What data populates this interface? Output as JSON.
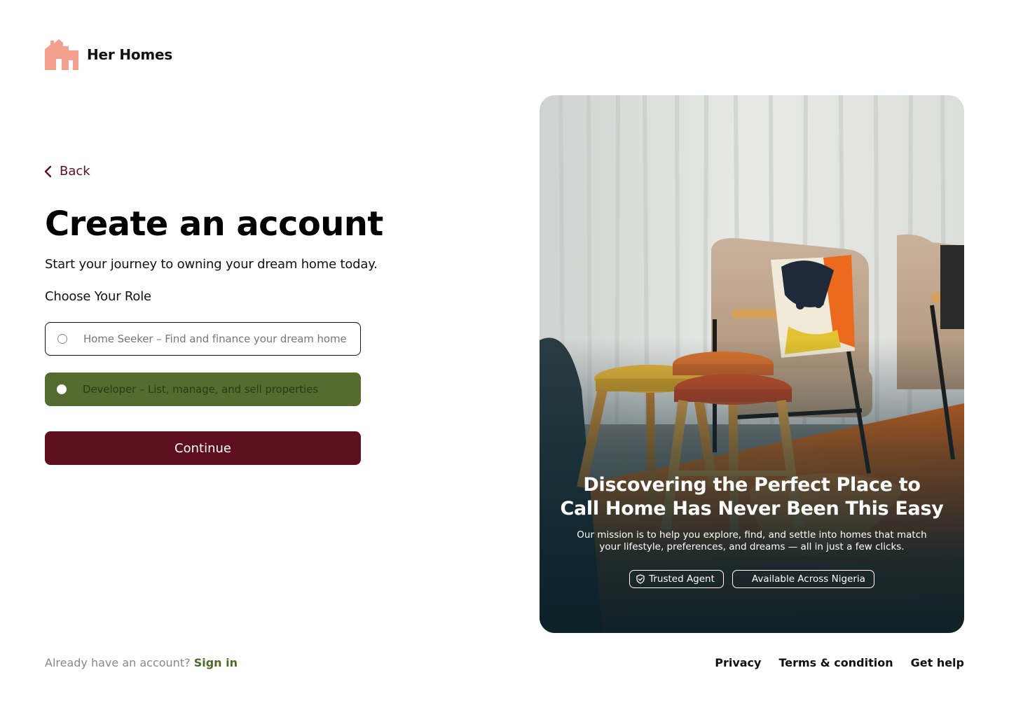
{
  "brand": {
    "name": "Her Homes",
    "logo_color": "#f4a08f"
  },
  "nav": {
    "back_label": "Back"
  },
  "form": {
    "title": "Create an account",
    "subtitle": "Start your journey to owning your dream home today.",
    "role_label": "Choose Your Role",
    "options": [
      {
        "label": "Home Seeker – Find and finance your dream home",
        "selected": false
      },
      {
        "label": "Developer – List, manage, and sell properties",
        "selected": true
      }
    ],
    "continue_label": "Continue"
  },
  "hero": {
    "title_line1": "Discovering the Perfect Place to",
    "title_line2": "Call Home Has Never Been This Easy",
    "desc_line1": "Our mission is to help you explore, find, and settle into homes that match",
    "desc_line2": "your lifestyle, preferences, and dreams — all in just a few clicks.",
    "badges": [
      "Trusted Agent",
      "Available Across Nigeria"
    ]
  },
  "footer": {
    "account_prompt": "Already have an account?",
    "signin_label": "Sign in",
    "links": [
      "Privacy",
      "Terms & condition",
      "Get help"
    ]
  },
  "colors": {
    "primary": "#5e0f1e",
    "accent_green": "#556b30",
    "signin_green": "#4d6b2a"
  }
}
